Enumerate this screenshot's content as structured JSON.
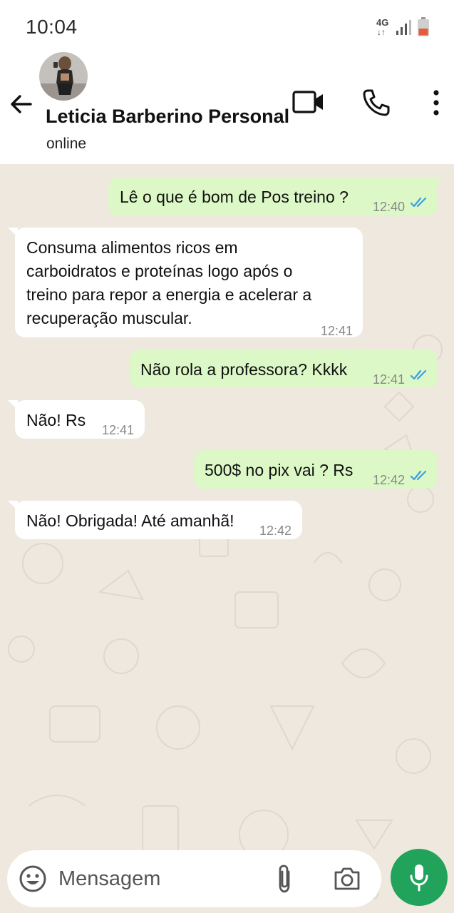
{
  "status_bar": {
    "time": "10:04",
    "network_label": "4G",
    "network_arrows": "↓↑",
    "icons": [
      "network-4g-icon",
      "signal-icon",
      "battery-icon"
    ]
  },
  "header": {
    "contact_name": "Leticia Barberino Personal",
    "status": "online",
    "icons": [
      "back-arrow-icon",
      "contact-avatar",
      "video-call-icon",
      "phone-call-icon",
      "more-options-icon"
    ]
  },
  "messages": [
    {
      "direction": "outgoing",
      "lines": [
        "Lê o que é bom de Pos treino ?"
      ],
      "time": "12:40",
      "read": true
    },
    {
      "direction": "incoming",
      "lines": [
        "Consuma alimentos ricos em",
        "carboidratos e proteínas logo após o",
        "treino para repor a energia e acelerar a",
        "recuperação muscular."
      ],
      "time": "12:41"
    },
    {
      "direction": "outgoing",
      "lines": [
        "Não rola a professora? Kkkk"
      ],
      "time": "12:41",
      "read": true
    },
    {
      "direction": "incoming",
      "lines": [
        "Não! Rs"
      ],
      "time": "12:41"
    },
    {
      "direction": "outgoing",
      "lines": [
        "500$ no pix vai ? Rs"
      ],
      "time": "12:42",
      "read": true
    },
    {
      "direction": "incoming",
      "lines": [
        "Não! Obrigada! Até amanhã!"
      ],
      "time": "12:42"
    }
  ],
  "composer": {
    "placeholder": "Mensagem",
    "icons": [
      "emoji-icon",
      "attach-icon",
      "camera-icon",
      "microphone-icon"
    ]
  },
  "colors": {
    "outgoing_bubble": "#dcf8c6",
    "incoming_bubble": "#ffffff",
    "chat_background": "#efe8de",
    "read_ticks": "#3a9fe0",
    "mic_button": "#21a35b"
  }
}
